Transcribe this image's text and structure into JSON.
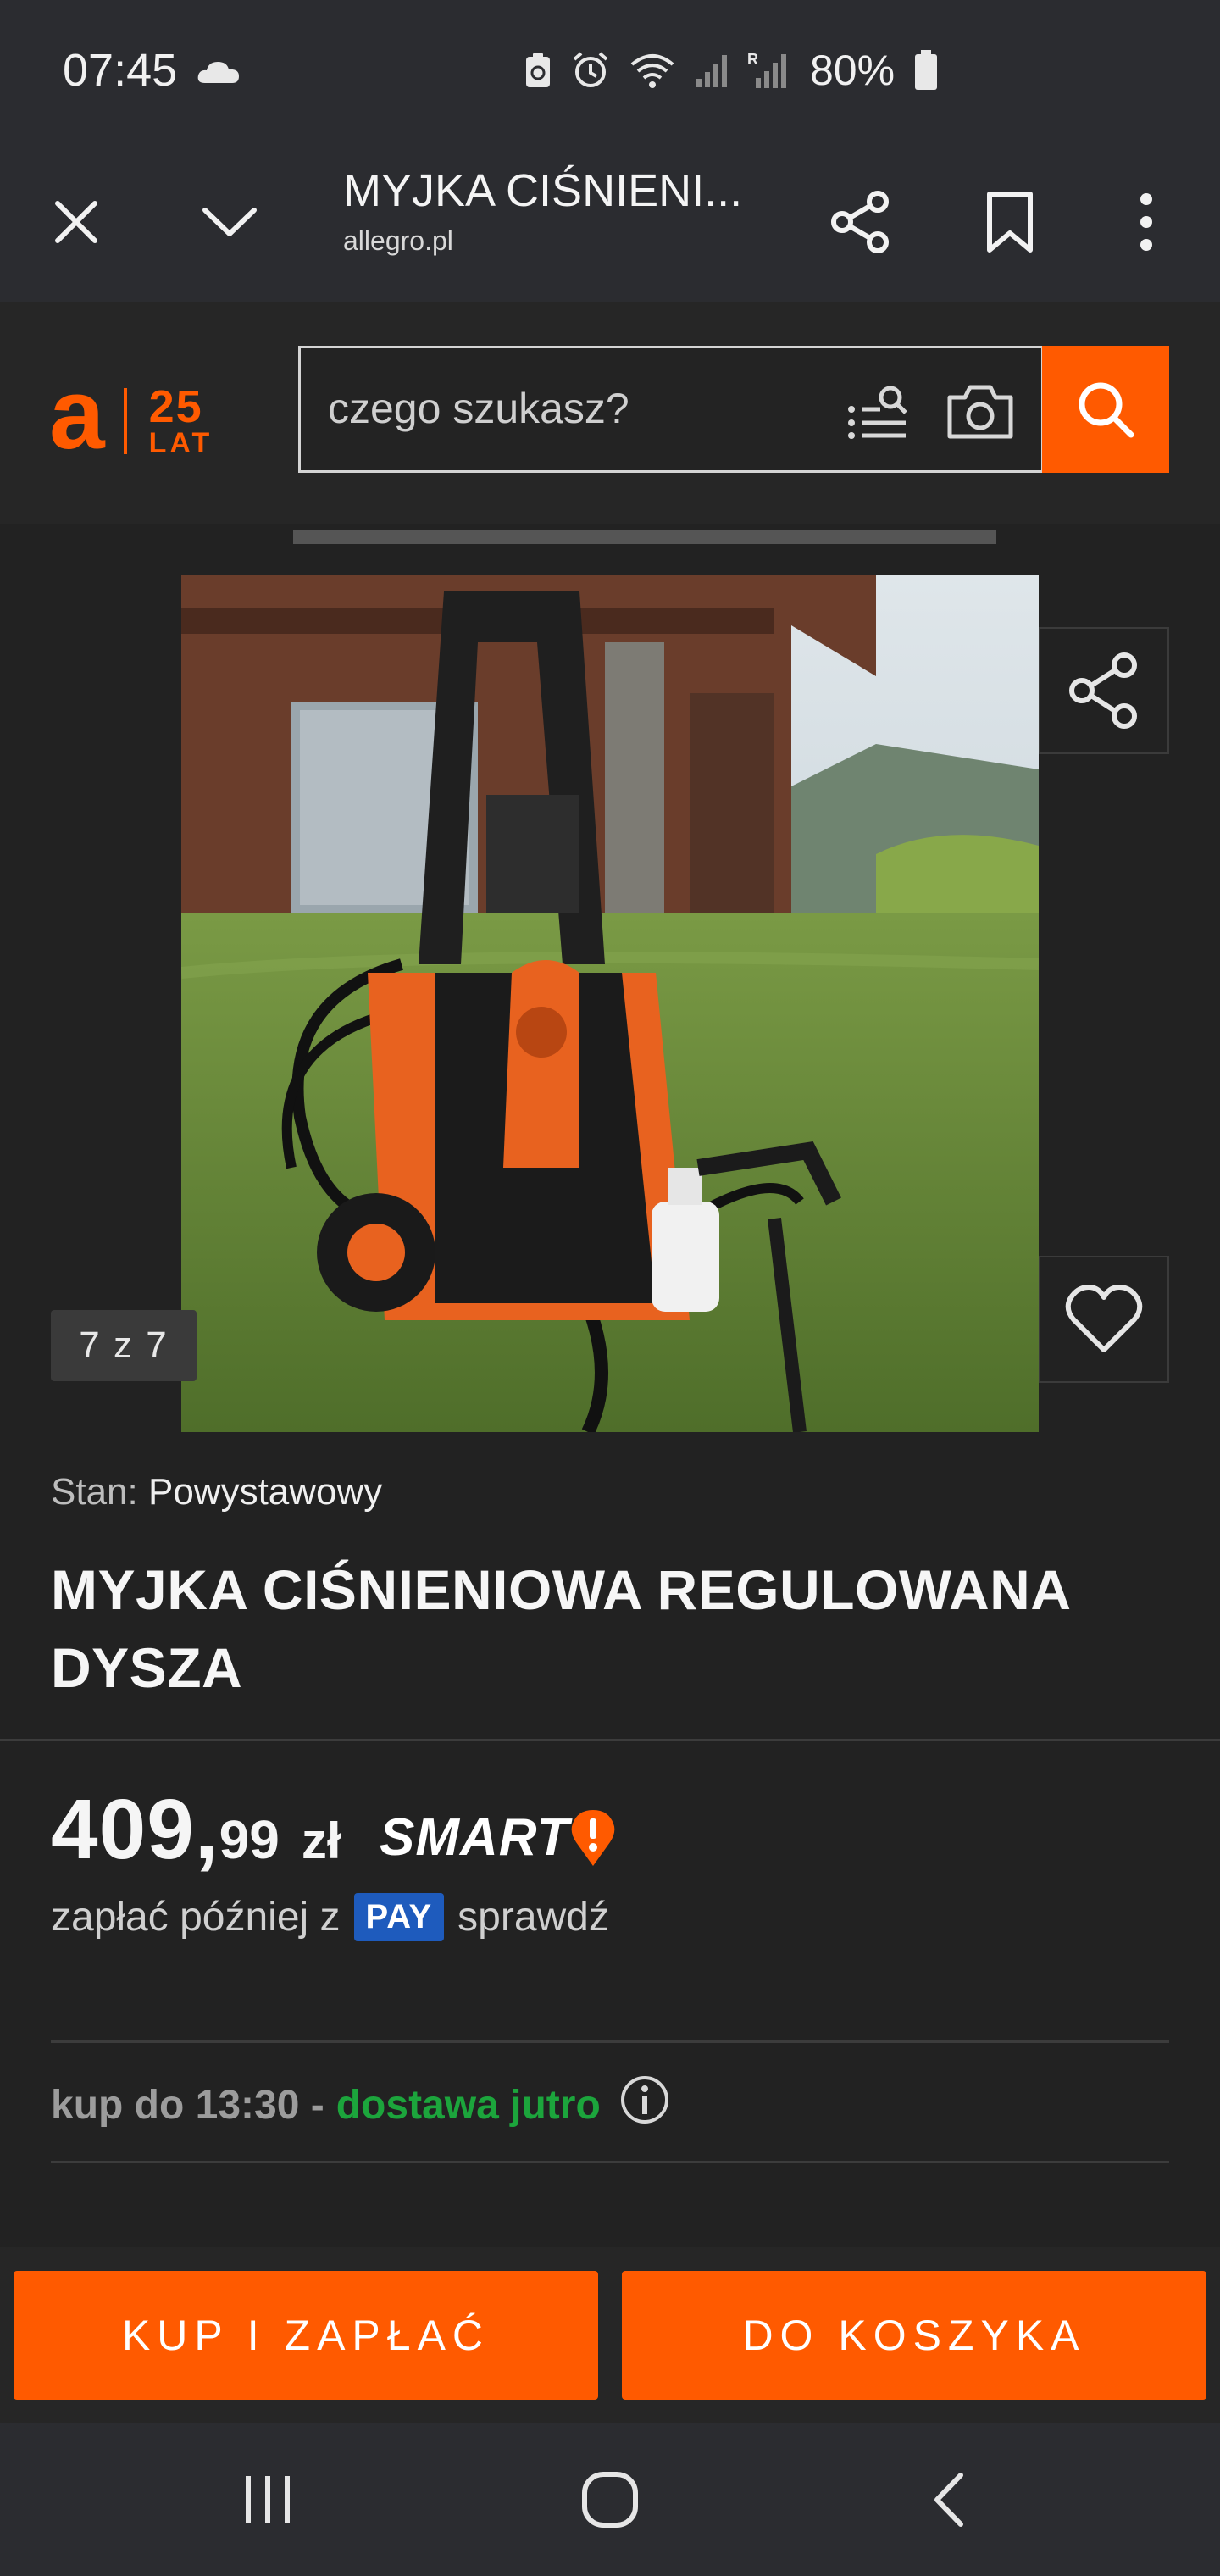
{
  "status_bar": {
    "time": "07:45",
    "battery": "80%",
    "icons": [
      "cloud-icon",
      "recycle-icon",
      "alarm-icon",
      "wifi-icon",
      "signal-icon",
      "signal-roaming-icon",
      "battery-icon"
    ]
  },
  "browser": {
    "title": "MYJKA CIŚNIENI...",
    "url": "allegro.pl",
    "icons": [
      "close-icon",
      "chevron-down-icon",
      "share-icon",
      "bookmark-icon",
      "more-vertical-icon"
    ]
  },
  "site_header": {
    "logo_letter": "a",
    "logo_number": "25",
    "logo_suffix": "LAT",
    "search_placeholder": "czego szukasz?",
    "brand_color": "#ff5a00"
  },
  "gallery": {
    "counter": "7 z 7",
    "image_alt": "Myjka ciśnieniowa na trawniku"
  },
  "product": {
    "state_label": "Stan:",
    "state_value": "Powystawowy",
    "title": "MYJKA CIŚNIENIOWA REGULOWANA DYSZA",
    "price_int": "409,",
    "price_dec": "99",
    "currency": "zł",
    "smart": "SMART",
    "pay_prefix": "zapłać później z",
    "pay_badge": "PAY",
    "pay_check": "sprawdź",
    "delivery_prefix": "kup do 13:30 -",
    "delivery_highlight": "dostawa jutro"
  },
  "actions": {
    "buy": "KUP I ZAPŁAĆ",
    "cart": "DO KOSZYKA"
  }
}
